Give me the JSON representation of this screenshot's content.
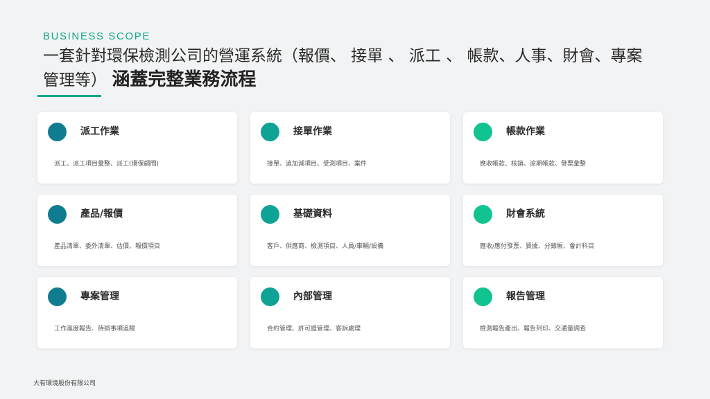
{
  "header": {
    "eyebrow": "BUSINESS SCOPE",
    "title_main": "一套針對環保檢測公司的營運系統（報價、 接單 、 派工 、 帳款、人事、財會、專案管理等）",
    "title_emphasis": "涵蓋完整業務流程"
  },
  "colors": {
    "accent": "#12a88a",
    "col1": "#107c8f",
    "col2": "#0ea395",
    "col3": "#10c391"
  },
  "cards": [
    {
      "title": "派工作業",
      "desc": "派工、派工項目彙整、派工(環保顧問)"
    },
    {
      "title": "接單作業",
      "desc": "接單、追加減項目、受測項目、案件"
    },
    {
      "title": "帳款作業",
      "desc": "應收帳款、核銷、逾期帳款、發票彙整"
    },
    {
      "title": "產品/報價",
      "desc": "產品清單、委外清單、估價、報價項目"
    },
    {
      "title": "基礎資料",
      "desc": "客戶、供應商、檢測項目、人員/車輛/設備"
    },
    {
      "title": "財會系統",
      "desc": "應收/應付發票、買據、分錄帳、會計科目"
    },
    {
      "title": "專案管理",
      "desc": "工作進度報告、待辦事項追蹤"
    },
    {
      "title": "內部管理",
      "desc": "合約管理、許可證管理、客訴處理"
    },
    {
      "title": "報告管理",
      "desc": "檢測報告產出、報告列印、交通量調查"
    }
  ],
  "footer": {
    "company": "大有環境股份有限公司"
  }
}
